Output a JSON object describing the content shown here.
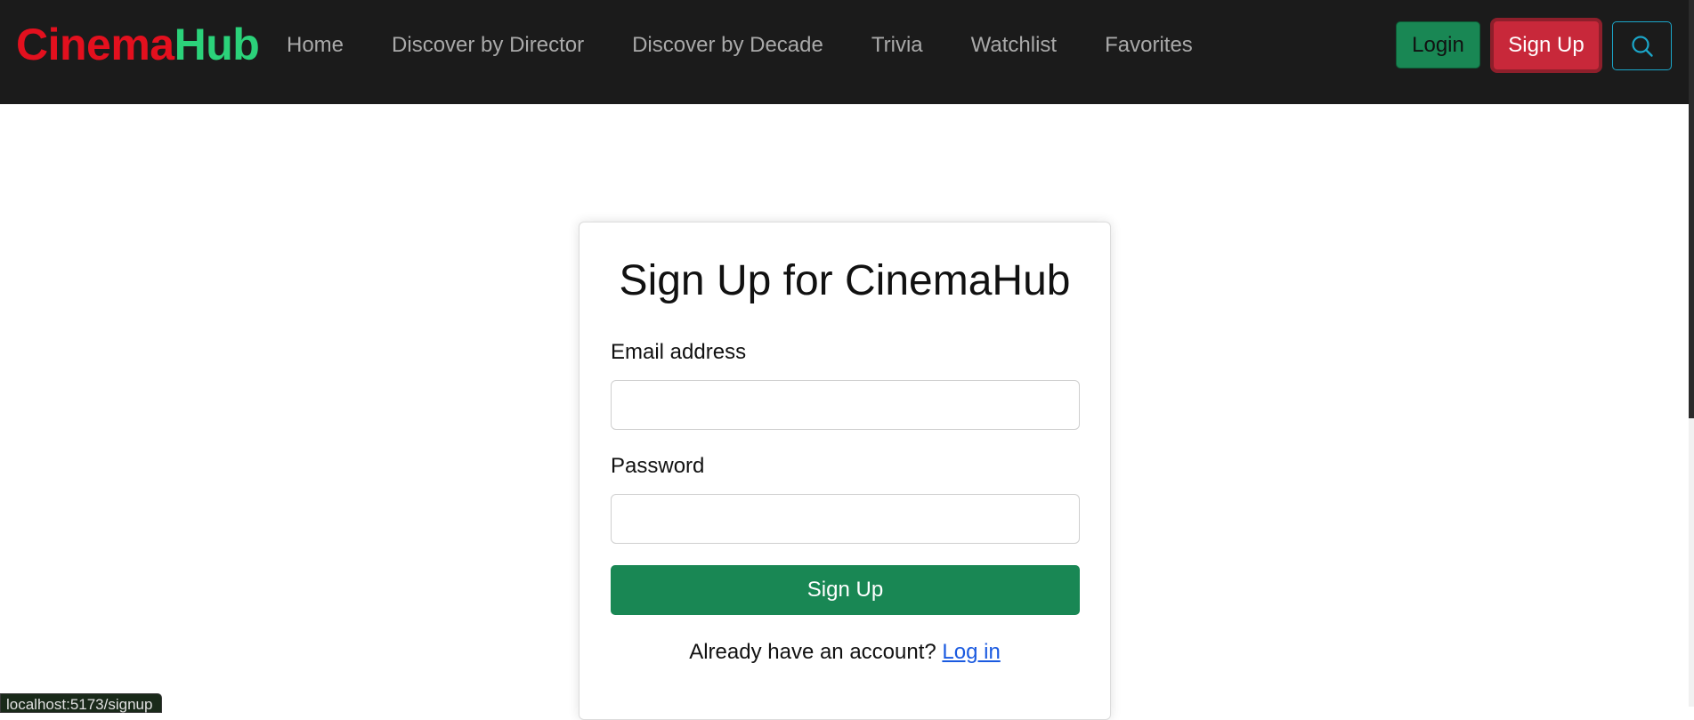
{
  "navbar": {
    "brand_part1": "Cinema",
    "brand_part2": "Hub",
    "links": [
      {
        "label": "Home"
      },
      {
        "label": "Discover by Director"
      },
      {
        "label": "Discover by Decade"
      },
      {
        "label": "Trivia"
      },
      {
        "label": "Watchlist"
      },
      {
        "label": "Favorites"
      }
    ],
    "login_label": "Login",
    "signup_label": "Sign Up",
    "search_icon": "search-icon"
  },
  "form": {
    "title": "Sign Up for CinemaHub",
    "email_label": "Email address",
    "email_value": "",
    "password_label": "Password",
    "password_value": "",
    "submit_label": "Sign Up",
    "footer_text": "Already have an account?",
    "footer_link": "Log in"
  },
  "status_bar": {
    "url": "localhost:5173/signup"
  },
  "colors": {
    "navbar_bg": "#1b1b1b",
    "brand_red": "#e3101e",
    "brand_green": "#2bd27a",
    "success_green": "#198754",
    "danger_red": "#c8283a",
    "info_cyan": "#1ba6c9",
    "link_blue": "#1a5ae0"
  }
}
